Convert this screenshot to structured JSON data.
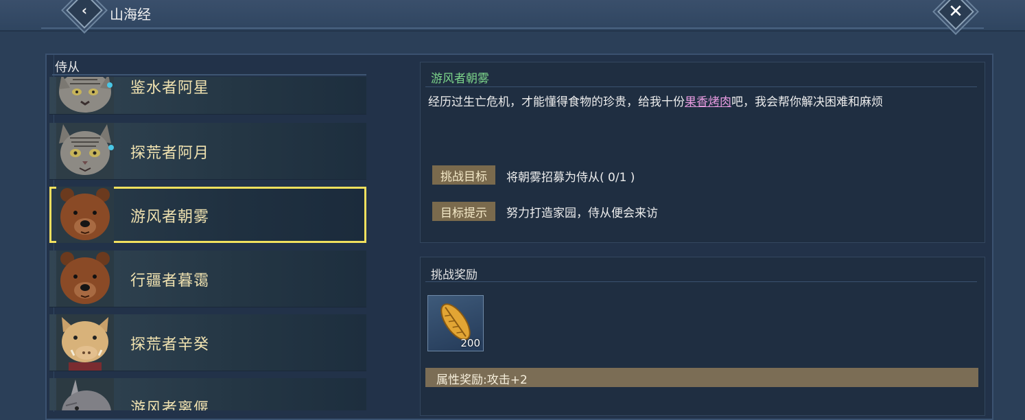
{
  "header": {
    "title": "山海经",
    "back_icon": "back-chevron-icon",
    "close_icon": "close-icon"
  },
  "companions": {
    "header": "侍从",
    "items": [
      {
        "name": "鉴水者阿星",
        "portrait": "cat-portrait-icon",
        "selected": false
      },
      {
        "name": "探荒者阿月",
        "portrait": "cat-portrait-icon",
        "selected": false
      },
      {
        "name": "游风者朝雾",
        "portrait": "bear-portrait-icon",
        "selected": true
      },
      {
        "name": "行疆者暮霭",
        "portrait": "bear-portrait-icon",
        "selected": false
      },
      {
        "name": "探荒者辛癸",
        "portrait": "boar-portrait-icon",
        "selected": false
      },
      {
        "name": "游风者离偃",
        "portrait": "rhino-portrait-icon",
        "selected": false
      }
    ]
  },
  "detail": {
    "name": "游风者朝雾",
    "description_pre": "经历过生亡危机，才能懂得食物的珍贵，给我十份",
    "description_highlight": "果香烤肉",
    "description_post": "吧，我会帮你解决困难和麻烦",
    "goal_tag": "挑战目标",
    "goal_text": "将朝雾招募为侍从( 0/1 )",
    "hint_tag": "目标提示",
    "hint_text": "努力打造家园，侍从便会来访"
  },
  "reward": {
    "title": "挑战奖励",
    "item_icon": "seed-shell-icon",
    "item_count": "200",
    "attribute": "属性奖励:攻击+2"
  },
  "colors": {
    "selected_border": "#f2e05e",
    "name_green": "#7cd48a",
    "highlight_pink": "#e79be0",
    "tag_bg": "#7a6a4d"
  }
}
